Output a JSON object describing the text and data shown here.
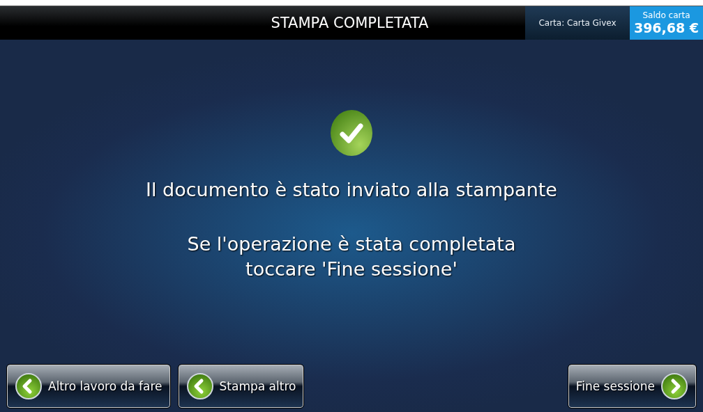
{
  "header": {
    "title": "STAMPA COMPLETATA",
    "card_label": "Carta: Carta Givex",
    "balance_label": "Saldo carta",
    "balance_value": "396,68 €"
  },
  "message": {
    "kind": "success",
    "lines": [
      "Il documento è stato inviato alla stampante",
      "Se l'operazione è stata completata",
      "toccare 'Fine sessione'"
    ]
  },
  "buttons": [
    {
      "label": "Altro lavoro da fare",
      "kind": "back"
    },
    {
      "label": "Stampa altro",
      "kind": "back"
    },
    {
      "label": "Fine sessione",
      "kind": "forward"
    }
  ]
}
